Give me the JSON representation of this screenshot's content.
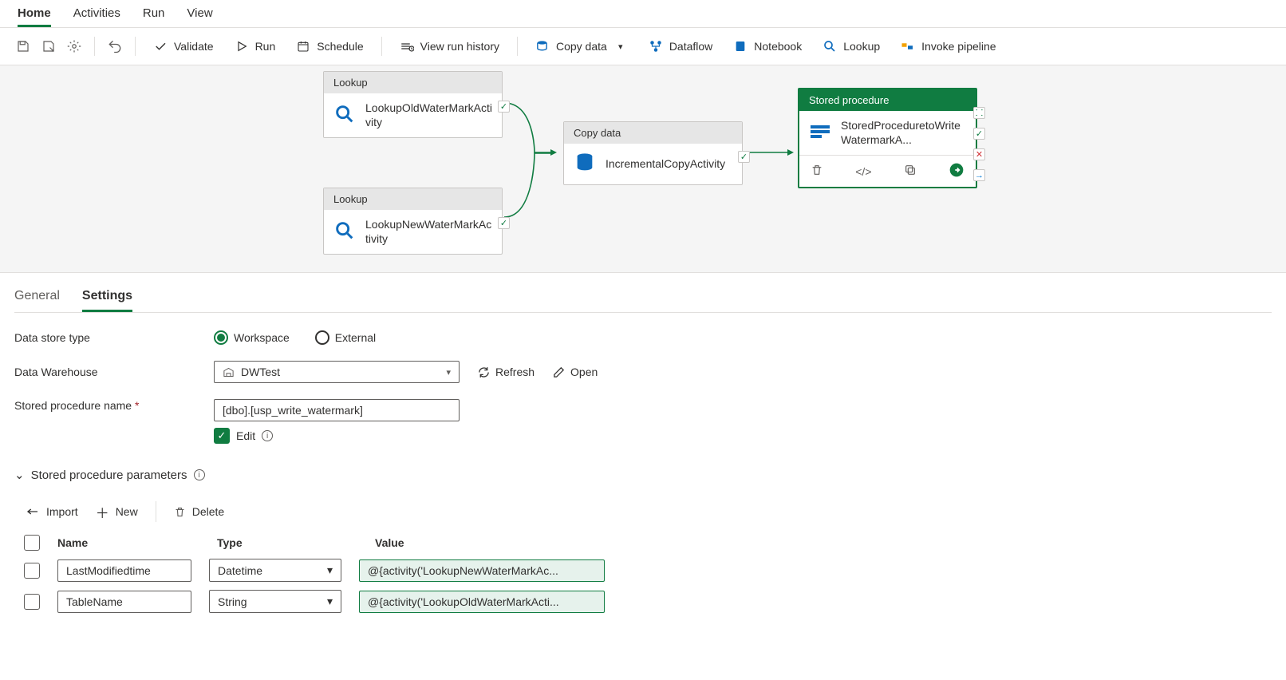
{
  "nav": {
    "tabs": [
      "Home",
      "Activities",
      "Run",
      "View"
    ],
    "active": 0
  },
  "toolbar": {
    "validate": "Validate",
    "run": "Run",
    "schedule": "Schedule",
    "history": "View run history",
    "copydata": "Copy data",
    "dataflow": "Dataflow",
    "notebook": "Notebook",
    "lookup": "Lookup",
    "invoke": "Invoke pipeline"
  },
  "canvas": {
    "lookup1": {
      "header": "Lookup",
      "name": "LookupOldWaterMarkActivity"
    },
    "lookup2": {
      "header": "Lookup",
      "name": "LookupNewWaterMarkActivity"
    },
    "copy": {
      "header": "Copy data",
      "name": "IncrementalCopyActivity"
    },
    "sp": {
      "header": "Stored procedure",
      "name": "StoredProceduretoWriteWatermarkA..."
    }
  },
  "panel": {
    "tabs": {
      "general": "General",
      "settings": "Settings"
    },
    "data_store_type_label": "Data store type",
    "radio_workspace": "Workspace",
    "radio_external": "External",
    "data_warehouse_label": "Data Warehouse",
    "data_warehouse_value": "DWTest",
    "refresh": "Refresh",
    "open": "Open",
    "sp_name_label": "Stored procedure name",
    "sp_name_value": "[dbo].[usp_write_watermark]",
    "edit": "Edit",
    "sp_params_label": "Stored procedure parameters",
    "import": "Import",
    "new": "New",
    "delete": "Delete",
    "headers": {
      "name": "Name",
      "type": "Type",
      "value": "Value"
    },
    "rows": [
      {
        "name": "LastModifiedtime",
        "type": "Datetime",
        "value": "@{activity('LookupNewWaterMarkAc..."
      },
      {
        "name": "TableName",
        "type": "String",
        "value": "@{activity('LookupOldWaterMarkActi..."
      }
    ]
  }
}
